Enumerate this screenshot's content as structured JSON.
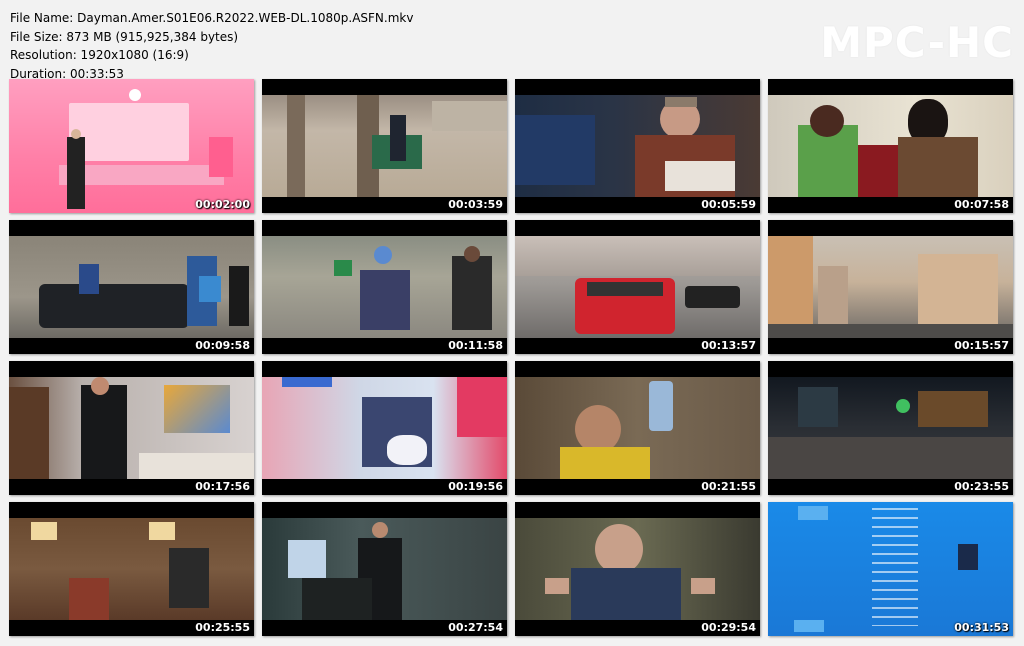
{
  "file_info": {
    "name": "File Name: Dayman.Amer.S01E06.R2022.WEB-DL.1080p.ASFN.mkv",
    "size": "File Size: 873 MB (915,925,384 bytes)",
    "resolution": "Resolution: 1920x1080 (16:9)",
    "duration": "Duration: 00:33:53"
  },
  "logo": "MPC-HC",
  "thumbnails": [
    {
      "time": "00:02:00"
    },
    {
      "time": "00:03:59"
    },
    {
      "time": "00:05:59"
    },
    {
      "time": "00:07:58"
    },
    {
      "time": "00:09:58"
    },
    {
      "time": "00:11:58"
    },
    {
      "time": "00:13:57"
    },
    {
      "time": "00:15:57"
    },
    {
      "time": "00:17:56"
    },
    {
      "time": "00:19:56"
    },
    {
      "time": "00:21:55"
    },
    {
      "time": "00:23:55"
    },
    {
      "time": "00:25:55"
    },
    {
      "time": "00:27:54"
    },
    {
      "time": "00:29:54"
    },
    {
      "time": "00:31:53"
    }
  ]
}
